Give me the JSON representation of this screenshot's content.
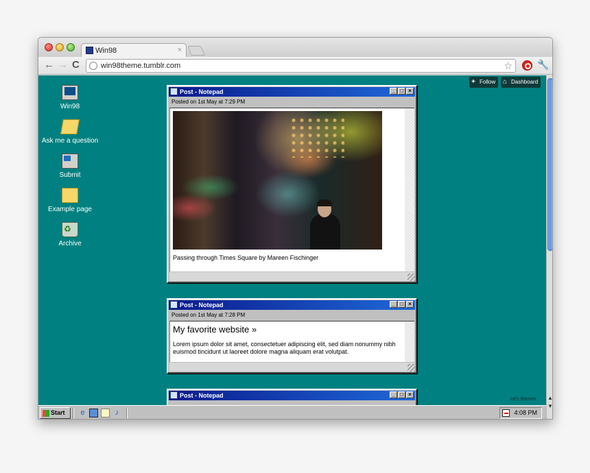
{
  "browser": {
    "tab_title": "Win98",
    "tab_close": "×",
    "url": "win98theme.tumblr.com",
    "nav": {
      "back": "←",
      "forward": "→",
      "reload": "C"
    },
    "star": "☆",
    "wrench": "🔧"
  },
  "tumblr": {
    "follow_label": "Follow",
    "follow_icon": "+",
    "dashboard_label": "Dashboard",
    "dashboard_icon": "⌂"
  },
  "desktop_icons": [
    {
      "label": "Win98",
      "icon": "computer-icon"
    },
    {
      "label": "Ask me a question",
      "icon": "open-folder-icon"
    },
    {
      "label": "Submit",
      "icon": "network-icon"
    },
    {
      "label": "Example page",
      "icon": "folder-icon"
    },
    {
      "label": "Archive",
      "icon": "recycle-bin-icon"
    }
  ],
  "windows": [
    {
      "title": "Post - Notepad",
      "meta": "Posted on 1st May at 7:29 PM",
      "caption": "Passing through Times Square by Mareen Fischinger"
    },
    {
      "title": "Post - Notepad",
      "meta": "Posted on 1st May at 7:28 PM",
      "post_title": "My favorite website »",
      "body": "Lorem ipsum dolor sit amet, consectetuer adipiscing elit, sed diam nonummy nibh euismod tincidunt ut laoreet dolore magna aliquam erat volutpat."
    },
    {
      "title": "Post - Notepad"
    }
  ],
  "window_buttons": {
    "minimize": "_",
    "maximize": "□",
    "close": "×"
  },
  "taskbar": {
    "start_label": "Start",
    "clock": "4:08 PM"
  },
  "credit": "ed's themes",
  "colors": {
    "desktop": "#008080",
    "caption_start": "#0a1a8c",
    "caption_end": "#1f68d8",
    "chrome": "#c0c0c0"
  }
}
